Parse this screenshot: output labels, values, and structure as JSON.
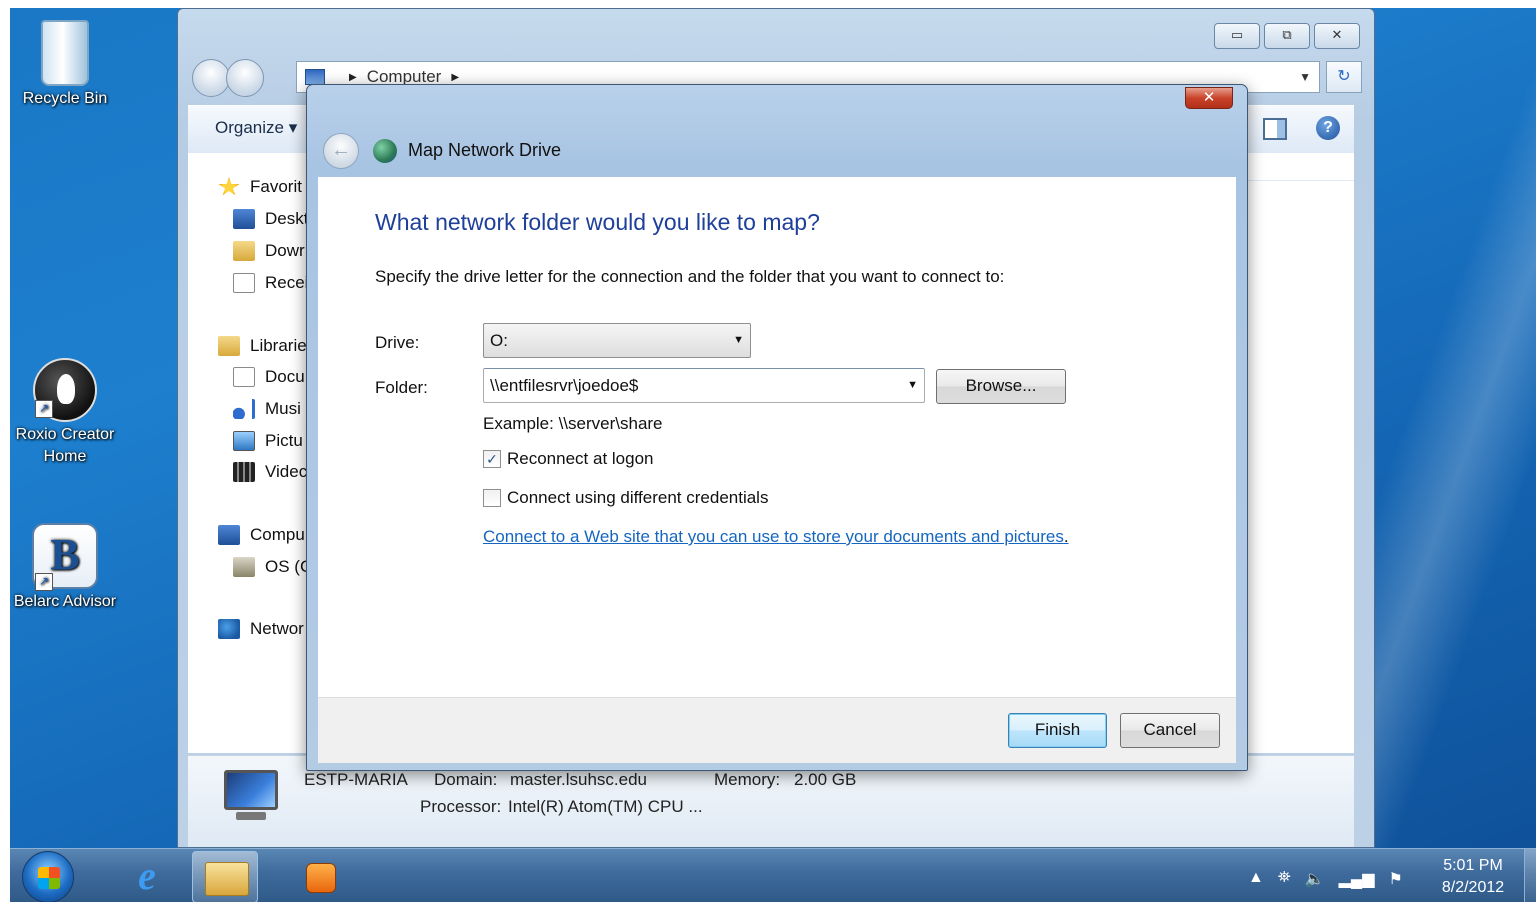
{
  "desktop": {
    "icons": [
      {
        "label": "Recycle Bin"
      },
      {
        "label": "Roxio Creator Home"
      },
      {
        "label": "Belarc Advisor",
        "glyph": "B"
      }
    ]
  },
  "explorer": {
    "address": {
      "segment": "Computer"
    },
    "toolbar": {
      "organize": "Organize ▾"
    },
    "window_controls": {
      "minimize": "▭",
      "maximize": "⧉",
      "close": "✕"
    },
    "nav": {
      "favorites": "Favorit",
      "desktop": "Deskt",
      "downloads": "Dowr",
      "recent": "Recei",
      "libraries": "Librarie",
      "documents": "Docu",
      "music": "Musi",
      "pictures": "Pictu",
      "videos": "Videc",
      "computer": "Compu",
      "os_drive": "OS (C",
      "network": "Networ"
    },
    "details": {
      "computer_name": "ESTP-MARIA",
      "domain_label": "Domain:",
      "domain_value": "master.lsuhsc.edu",
      "memory_label": "Memory:",
      "memory_value": "2.00 GB",
      "processor_label": "Processor:",
      "processor_value": "Intel(R) Atom(TM) CPU ..."
    }
  },
  "dialog": {
    "title": "Map Network Drive",
    "close": "✕",
    "heading": "What network folder would you like to map?",
    "instruction": "Specify the drive letter for the connection and the folder that you want to connect to:",
    "drive_label": "Drive:",
    "drive_value": "O:",
    "folder_label": "Folder:",
    "folder_value": "\\\\entfilesrvr\\joedoe$",
    "browse": "Browse...",
    "example": "Example: \\\\server\\share",
    "reconnect": {
      "label": "Reconnect at logon",
      "checked": true
    },
    "credentials": {
      "label": "Connect using different credentials",
      "checked": false
    },
    "link": "Connect to a Web site that you can use to store your documents and pictures",
    "finish": "Finish",
    "cancel": "Cancel"
  },
  "taskbar": {
    "clock_time": "5:01 PM",
    "clock_date": "8/2/2012",
    "tray_icons": [
      "▲",
      "network-icon",
      "volume-icon",
      "signal-icon",
      "action-center-icon"
    ]
  }
}
